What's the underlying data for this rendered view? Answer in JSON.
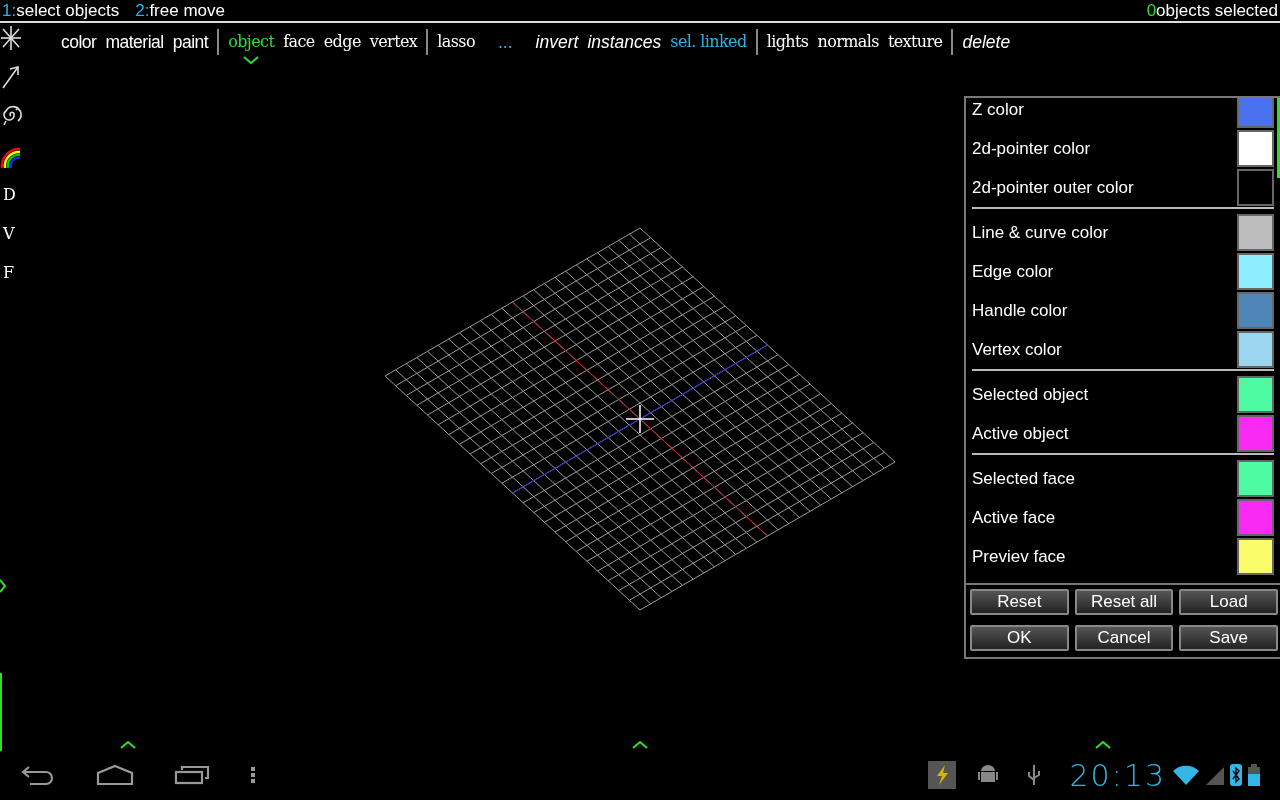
{
  "top_bar": {
    "hints": [
      {
        "key": "1:",
        "label": "select objects"
      },
      {
        "key": "2:",
        "label": "free move"
      }
    ],
    "status": {
      "count": "0",
      "label": "objects selected"
    }
  },
  "toolbar": {
    "groups": [
      {
        "items": [
          {
            "label": "color",
            "kind": "sans"
          },
          {
            "label": "material",
            "kind": "sans"
          },
          {
            "label": "paint",
            "kind": "sans"
          }
        ]
      },
      {
        "items": [
          {
            "label": "object",
            "kind": "mode",
            "selected": true
          },
          {
            "label": "face",
            "kind": "mode",
            "selected": false
          },
          {
            "label": "edge",
            "kind": "mode",
            "selected": false
          },
          {
            "label": "vertex",
            "kind": "mode",
            "selected": false
          }
        ]
      },
      {
        "items": [
          {
            "label": "lasso",
            "kind": "serif"
          },
          {
            "label": "...",
            "kind": "more"
          },
          {
            "label": "invert",
            "kind": "italic"
          },
          {
            "label": "instances",
            "kind": "italic"
          },
          {
            "label": "sel. linked",
            "kind": "link"
          }
        ]
      },
      {
        "items": [
          {
            "label": "lights",
            "kind": "serif"
          },
          {
            "label": "normals",
            "kind": "serif"
          },
          {
            "label": "texture",
            "kind": "serif"
          }
        ]
      },
      {
        "items": [
          {
            "label": "delete",
            "kind": "italic"
          }
        ]
      }
    ]
  },
  "side_tools": [
    {
      "kind": "asterisk"
    },
    {
      "kind": "arrow"
    },
    {
      "kind": "spiral"
    },
    {
      "kind": "rainbow"
    },
    {
      "kind": "letter",
      "label": "D"
    },
    {
      "kind": "letter",
      "label": "V"
    },
    {
      "kind": "letter",
      "label": "F"
    }
  ],
  "color_panel": {
    "sections": [
      [
        {
          "label": "Z color",
          "color": "#4a72f0"
        },
        {
          "label": "2d-pointer color",
          "color": "#ffffff"
        },
        {
          "label": "2d-pointer outer color",
          "color": "#000000"
        }
      ],
      [
        {
          "label": "Line & curve color",
          "color": "#bdbdbd"
        },
        {
          "label": "Edge color",
          "color": "#8ceeff"
        },
        {
          "label": "Handle color",
          "color": "#4f86b8"
        },
        {
          "label": "Vertex color",
          "color": "#9ad6f0"
        }
      ],
      [
        {
          "label": "Selected object",
          "color": "#4dfba3"
        },
        {
          "label": "Active object",
          "color": "#fa2af5"
        }
      ],
      [
        {
          "label": "Selected face",
          "color": "#4dfba3"
        },
        {
          "label": "Active face",
          "color": "#fa2af5"
        },
        {
          "label": "Previev face",
          "color": "#fbfc6a"
        }
      ]
    ],
    "buttons": [
      [
        "Reset",
        "Reset all",
        "Load"
      ],
      [
        "OK",
        "Cancel",
        "Save"
      ]
    ]
  },
  "system_bar": {
    "time": "20:13"
  }
}
